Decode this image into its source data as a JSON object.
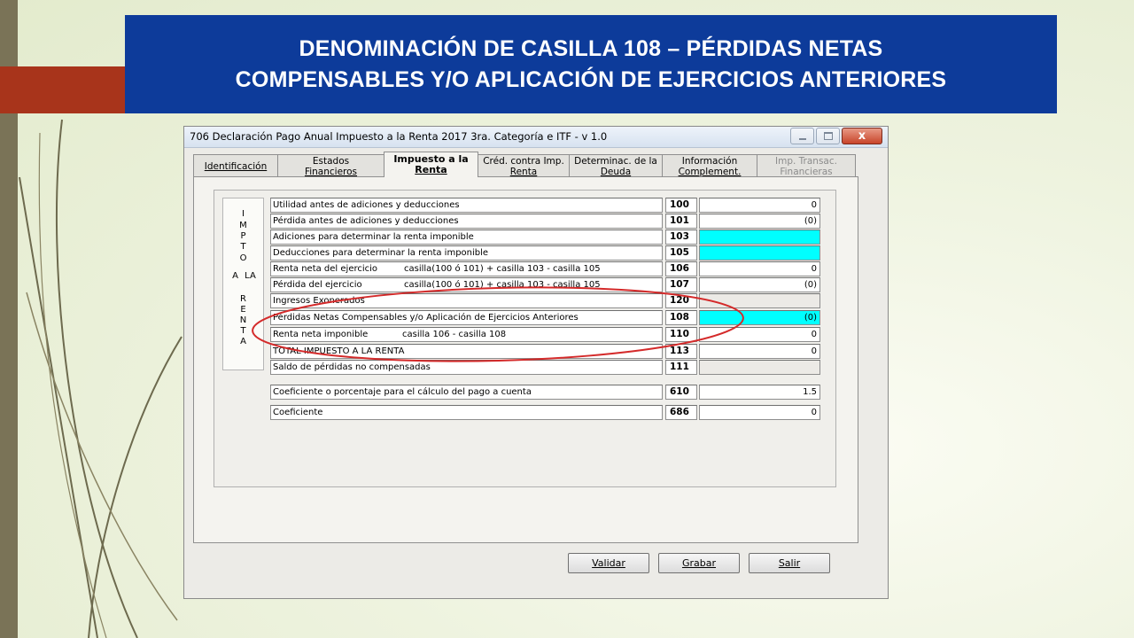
{
  "slide": {
    "title_line1": "DENOMINACIÓN DE CASILLA 108 – PÉRDIDAS NETAS",
    "title_line2": "COMPENSABLES Y/O APLICACIÓN DE EJERCICIOS ANTERIORES",
    "colors": {
      "title_band": "#0d3b9a",
      "accent_red": "#a8341b",
      "left_bar": "#7a7357"
    }
  },
  "window": {
    "title": "706 Declaración Pago Anual Impuesto a la Renta 2017 3ra. Categoría e ITF - v 1.0",
    "close_glyph": "x"
  },
  "tabs": [
    {
      "l1": "Identificación",
      "l2": ""
    },
    {
      "l1": "Estados",
      "l2": "Financieros"
    },
    {
      "l1": "Impuesto a la",
      "l2": "Renta"
    },
    {
      "l1": "Créd. contra Imp.",
      "l2": "Renta"
    },
    {
      "l1": "Determinac. de la",
      "l2": "Deuda"
    },
    {
      "l1": "Información",
      "l2": "Complement."
    },
    {
      "l1": "Imp. Transac.",
      "l2": "Financieras"
    }
  ],
  "vertical_label": [
    "I",
    "M",
    "P",
    "T",
    "O",
    "A",
    "LA",
    "R",
    "E",
    "N",
    "T",
    "A"
  ],
  "rows": [
    {
      "desc": "Utilidad antes de adiciones y deducciones",
      "formula": "",
      "code": "100",
      "value": "0"
    },
    {
      "desc": "Pérdida antes de adiciones y deducciones",
      "formula": "",
      "code": "101",
      "value": "(0)"
    },
    {
      "desc": "Adiciones para determinar la renta imponible",
      "formula": "",
      "code": "103",
      "value": ""
    },
    {
      "desc": "Deducciones para determinar la renta imponible",
      "formula": "",
      "code": "105",
      "value": ""
    },
    {
      "desc": "Renta neta del ejercicio",
      "formula": "casilla(100 ó 101) + casilla 103 - casilla 105",
      "code": "106",
      "value": "0"
    },
    {
      "desc": "Pérdida del ejercicio",
      "formula": "casilla(100 ó 101) + casilla 103 - casilla 105",
      "code": "107",
      "value": "(0)"
    },
    {
      "desc": "Ingresos Exonerados",
      "formula": "",
      "code": "120",
      "value": ""
    },
    {
      "desc": "Pérdidas Netas Compensables y/o Aplicación de Ejercicios Anteriores",
      "formula": "",
      "code": "108",
      "value": "(0)"
    },
    {
      "desc": "Renta neta imponible",
      "formula": "casilla 106 - casilla 108",
      "code": "110",
      "value": "0"
    },
    {
      "desc": "TOTAL IMPUESTO A LA RENTA",
      "formula": "",
      "code": "113",
      "value": "0"
    },
    {
      "desc": "Saldo de pérdidas no compensadas",
      "formula": "",
      "code": "111",
      "value": ""
    },
    {
      "desc": "Coeficiente o porcentaje para el cálculo del pago a cuenta",
      "formula": "",
      "code": "610",
      "value": "1.5"
    },
    {
      "desc": "Coeficiente",
      "formula": "",
      "code": "686",
      "value": "0"
    }
  ],
  "buttons": {
    "validar": "Validar",
    "grabar": "Grabar",
    "salir": "Salir"
  },
  "highlight_color": "#d42a2a",
  "cyan_field_color": "#00ffff"
}
